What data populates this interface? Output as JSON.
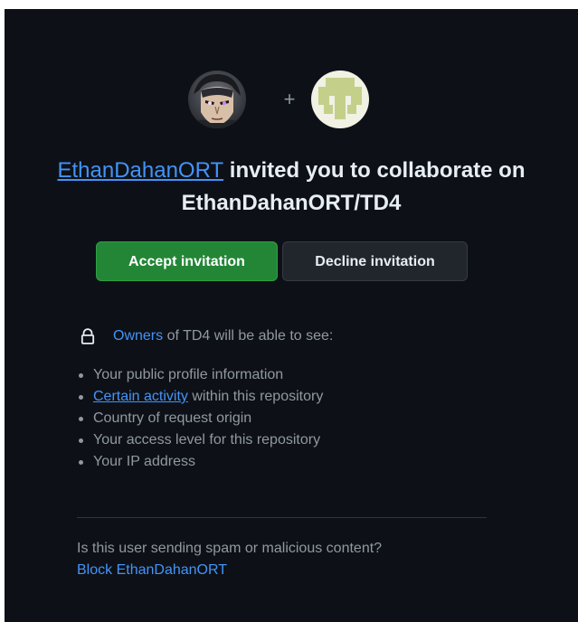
{
  "invite": {
    "inviter": "EthanDahanORT",
    "message": " invited you to collaborate on",
    "repository": "EthanDahanORT/TD4",
    "plus_symbol": "+"
  },
  "actions": {
    "accept_label": "Accept invitation",
    "decline_label": "Decline invitation"
  },
  "visibility": {
    "owners_link": "Owners",
    "text": " of TD4 will be able to see:",
    "icon": "lock-icon"
  },
  "permissions": [
    {
      "text": "Your public profile information"
    },
    {
      "link": "Certain activity",
      "text": " within this repository"
    },
    {
      "text": "Country of request origin"
    },
    {
      "text": "Your access level for this repository"
    },
    {
      "text": "Your IP address"
    }
  ],
  "spam": {
    "question": "Is this user sending spam or malicious content?",
    "block_label": "Block EthanDahanORT"
  },
  "colors": {
    "background": "#0d1117",
    "accent_link": "#4493f8",
    "accept_button": "#238636",
    "decline_button": "#21262d",
    "muted_text": "#9198a1"
  }
}
